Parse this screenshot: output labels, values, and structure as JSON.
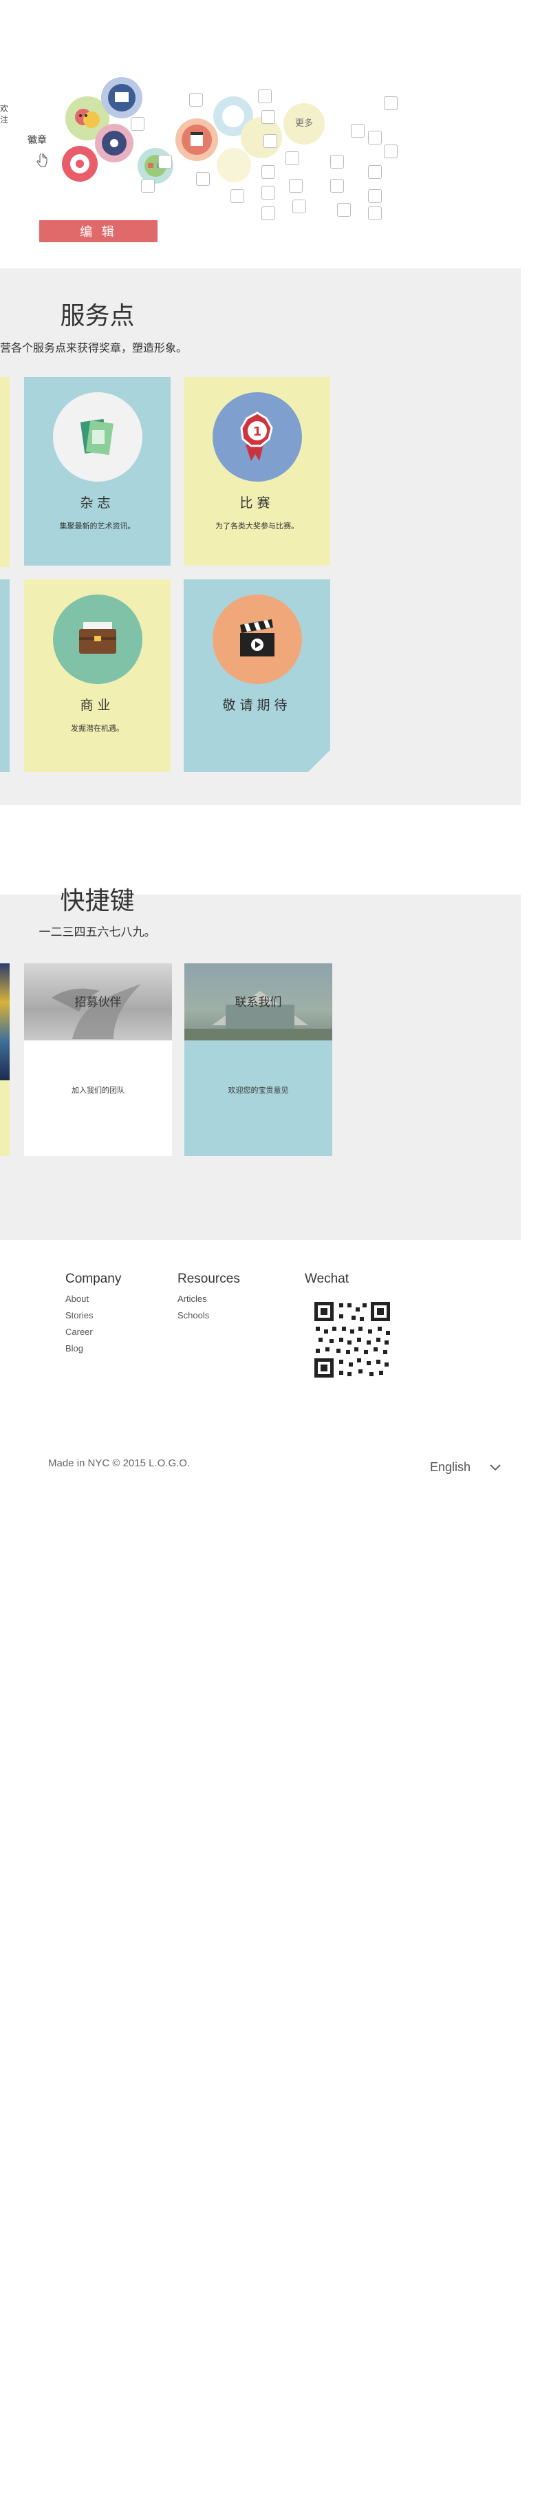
{
  "top": {
    "left_text_line1": "欢",
    "left_text_line2": "注",
    "badge_label": "徽章",
    "more_label": "更多",
    "edit_button": "编 辑"
  },
  "service": {
    "title": "服务点",
    "subtitle": "营各个服务点来获得奖章，塑造形象。",
    "tiles": [
      {
        "title": "杂志",
        "desc": "集聚最新的艺术资讯。",
        "icon": "magazine-icon",
        "color": "#a9d4dc"
      },
      {
        "title": "比赛",
        "desc": "为了各类大奖参与比赛。",
        "icon": "medal-icon",
        "color": "#f2efb3"
      },
      {
        "title": "商业",
        "desc": "发掘潜在机遇。",
        "icon": "briefcase-icon",
        "color": "#f2efb3"
      },
      {
        "title": "敬请期待",
        "desc": "",
        "icon": "clapperboard-icon",
        "color": "#a9d4dc"
      }
    ]
  },
  "shortcut": {
    "title": "快捷键",
    "subtitle": "一二三四五六七八九。",
    "cards": [
      {
        "title": "招募伙伴",
        "desc": "加入我们的团队"
      },
      {
        "title": "联系我们",
        "desc": "欢迎您的宝贵意见"
      }
    ]
  },
  "footer": {
    "company": {
      "heading": "Company",
      "links": [
        "About",
        "Stories",
        "Career",
        "Blog"
      ]
    },
    "resources": {
      "heading": "Resources",
      "links": [
        "Articles",
        "Schools"
      ]
    },
    "wechat": {
      "heading": "Wechat"
    },
    "copyright": "Made in NYC © 2015 L.O.G.O.",
    "language": "English"
  },
  "colors": {
    "accent_red": "#e06a6a",
    "tile_blue": "#a9d4dc",
    "tile_yellow": "#f2efb3",
    "section_gray": "#efefef"
  }
}
